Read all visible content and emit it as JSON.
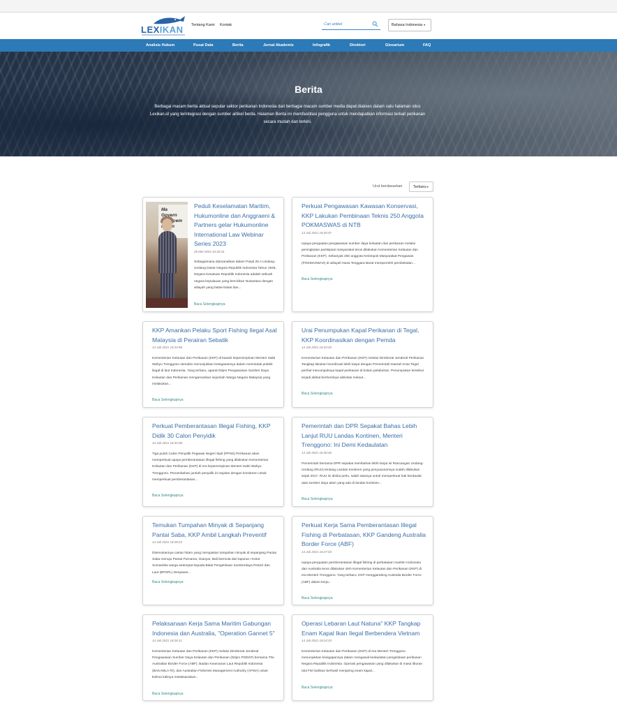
{
  "header": {
    "logo_text_a": "LEX",
    "logo_text_b": "IKAN",
    "links": [
      "Tentang Kami",
      "Kontak"
    ],
    "search_placeholder": "Cari artikel",
    "language": "Bahasa Indonesia"
  },
  "nav": [
    "Analisis Hukum",
    "Pusat Data",
    "Berita",
    "Jurnal Akademis",
    "Infografik",
    "Direktori",
    "Glosarium",
    "FAQ"
  ],
  "hero": {
    "title": "Berita",
    "description": "Berbagai macam berita aktual seputar sektor perikanan Indonesia dari berbagai macam sumber media dapat diakses dalam satu halaman situs Lexikan.id yang terintegrasi dengan sumber artikel berita. Halaman Berita ini memfasilitasi pengguna untuk mendapatkan informasi terkait perikanan secara mudah dan terkini."
  },
  "sort": {
    "label": "Urut berdasarkan",
    "value": "Terbaru"
  },
  "read_more": "Baca Selengkapnya",
  "featured_image_text": "Ma\nGovern\nEnforcement\nFishin",
  "articles": [
    {
      "title": "Peduli Keselamatan Maritim, Hukumonline dan Anggraeni & Partners gelar Hukumonline International Law Webinar Series 2023",
      "date": "29 Mei 2023 15:20:41",
      "excerpt": "Sebagaimana diamanatkan dalam Pasal 25 A Undang-Undang Dasar Negara Republik Indonesia Tahun 1945, Negara Kesatuan Republik Indonesia adalah sebuah negara kepulauan yang bercirikan Nusantara dengan wilayah yang batas-batas dan..."
    },
    {
      "title": "Perkuat Pengawasan Kawasan Konservasi, KKP Lakukan Pembinaan Teknis 250 Anggota POKMASWAS di NTB",
      "date": "14 Juli 2021 16:35:07",
      "excerpt": "Upaya penguatan pengawasan sumber daya kelautan dan perikanan melalui peningkatan partisipasi masyarakat terus dilakukan Kementerian Kelautan dan Perikanan (KKP). Sebanyak 250 anggota Kelompok Masyarakat Pengawas (POKMASWAS) di wilayah Nusa Tenggara Barat memperoleh pembekalan..."
    },
    {
      "title": "KKP Amankan Pelaku Sport Fishing Ilegal Asal Malaysia di Perairan Sebatik",
      "date": "14 Juli 2021 16:34:58",
      "excerpt": "Kementerian Kelautan dan Perikanan (KKP) di bawah kepemimpinan Menteri Sakti Wahyu Trenggono semakin menunjukkan ketegasannya dalam memindak praktik ilegal di laut Indonesia. Yang terbaru, aparat Ditjen Pengawasan Sumber Daya Kelautan dan Perikanan mengamankan sejumlah Warga Negara Malaysia yang melakukan..."
    },
    {
      "title": "Urai Penumpukan Kapal Perikanan di Tegal, KKP Koordinasikan dengan Pemda",
      "date": "14 Juli 2021 16:33:20",
      "excerpt": "Kementerian Kelautan dan Perikanan (KKP) melalui Direktorat Jenderal Perikanan Tangkap lakukan koordinasi lebih lanjut dengan Pemerintah Daerah Kota Tegal perihal menumpuknya kapal perikanan di kolam pelabuhan. Penumpukan tersebut terjadi akibat berhentinya aktivitas melaut..."
    },
    {
      "title": "Perkuat Pemberantasan Illegal Fishing, KKP Didik 30 Calon Penyidik",
      "date": "14 Juli 2021 16:32:08",
      "excerpt": "Tiga puluh Calon Penyidik Pegawai Negeri Sipil (PPNS) Perikanan akan memperkuat upaya pemberantasan illegal fishing yang dilakukan Kementerian Kelautan dan Perikanan (KKP) di era kepemimpinan Menteri Sakti Wahyu Trenggono. Penambahan jumlah penyidik ini sejalan dengan komitmen untuk memperkuat pemberantasan..."
    },
    {
      "title": "Pemerintah dan DPR Sepakat Bahas Lebih Lanjut RUU Landas Kontinen, Menteri Trenggono: Ini Demi Kedaulatan",
      "date": "14 Juli 2021 16:30:40",
      "excerpt": "Pemerintah bersama DPR sepakat membahas lebih lanjut isi Rancangan Undang-Undang (RUU) tentang Landas Kontinen yang penyusunannya sudah dilakukan sejak 2017. RUU ini dinilai perlu, salah satunya untuk memperkuat hak berdaulat atas sumber daya alam yang ada di landas kontinen..."
    },
    {
      "title": "Temukan Tumpahan Minyak di Sepanjang Pantai Saba, KKP Ambil Langkah Preventif",
      "date": "14 Juli 2021 16:28:22",
      "excerpt": "Ditemukannya cairan hitam yang merupakan tumpahan minyak di sepanjang Pantai Saba menuju Pantai Purnama, Gianyar, Bali bermula dari laporan I Ketut Sumantika warga setempat kepada Balai Pengelolaan Sumberdaya Pesisir dan Laut (BPSPL) Denpasar..."
    },
    {
      "title": "Perkuat Kerja Sama Pemberantasan Illegal Fishing di Perbatasan, KKP Gandeng Australia Border Force (ABF)",
      "date": "14 Juli 2021 16:27:53",
      "excerpt": "Upaya penguatan pemberantasan illegal fishing di perbatasan maritim Indonesia dan Australia terus dilakukan oleh Kementerian Kelautan dan Perikanan (KKP) di era Menteri Trenggono. Yang terbaru, KKP menggandeng Australia Border Force (ABF) dalam kerja..."
    },
    {
      "title": "Pelaksanaan Kerja Sama Maritim Gabungan Indonesia dan Australia, \"Operation Gannet 5\"",
      "date": "14 Juli 2021 16:26:11",
      "excerpt": "Kementerian Kelautan dan Perikanan (KKP) melalui Direktorat Jenderal Pengawasan Sumber Daya Kelautan dan Perikanan (Ditjen PSDKP) bersama The Australian Border Force (ABF), Badan Keamanan Laut Republik Indonesia (BAKAMLA RI), dan Australian Fisheries Management Authority (AFMA) untuk kelima kalinya melaksanakan..."
    },
    {
      "title": "Operasi Lebaran Laut Natuna\" KKP Tangkap Enam Kapal Ikan Ilegal Berbendera Vietnam",
      "date": "14 Juli 2021 16:24:25",
      "excerpt": "Kementerian Kelautan dan Perikanan (KKP) di era Menteri Trenggono menunjukkan kesigapannya dalam mengawal kedaulatan pengelolaan perikanan Negara Republik Indonesia. Operasi pengawasan yang dilakukan di masa liburan Idul Fitri bahkan berhasil menjaring enam kapal..."
    }
  ]
}
